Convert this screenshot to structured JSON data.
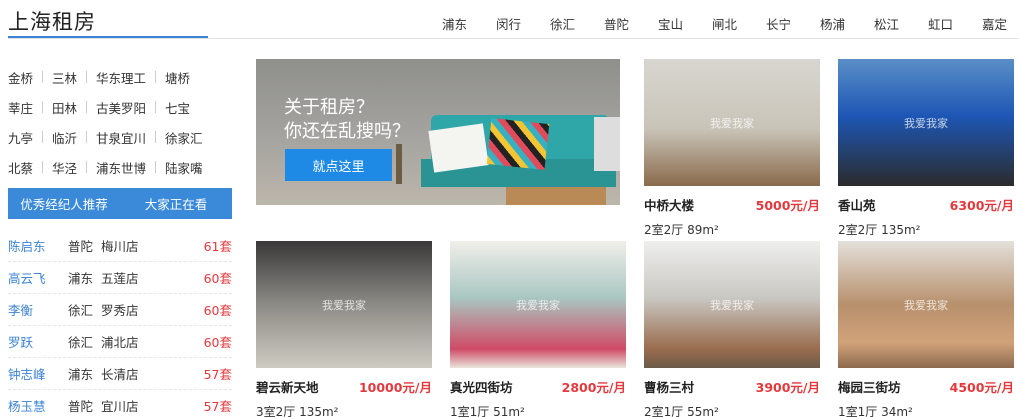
{
  "header": {
    "title": "上海租房",
    "districts": [
      "浦东",
      "闵行",
      "徐汇",
      "普陀",
      "宝山",
      "闸北",
      "长宁",
      "杨浦",
      "松江",
      "虹口",
      "嘉定"
    ]
  },
  "areas": [
    [
      "金桥",
      "三林",
      "华东理工",
      "塘桥"
    ],
    [
      "莘庄",
      "田林",
      "古美罗阳",
      "七宝"
    ],
    [
      "九亭",
      "临沂",
      "甘泉宜川",
      "徐家汇"
    ],
    [
      "北蔡",
      "华泾",
      "浦东世博",
      "陆家嘴"
    ]
  ],
  "tabs": [
    "优秀经纪人推荐",
    "大家正在看"
  ],
  "agents": [
    {
      "name": "陈启东",
      "district": "普陀",
      "store": "梅川店",
      "count": "61套"
    },
    {
      "name": "高云飞",
      "district": "浦东",
      "store": "五莲店",
      "count": "60套"
    },
    {
      "name": "李衡",
      "district": "徐汇",
      "store": "罗秀店",
      "count": "60套"
    },
    {
      "name": "罗跃",
      "district": "徐汇",
      "store": "浦北店",
      "count": "60套"
    },
    {
      "name": "钟志峰",
      "district": "浦东",
      "store": "长清店",
      "count": "57套"
    },
    {
      "name": "杨玉慧",
      "district": "普陀",
      "store": "宜川店",
      "count": "57套"
    }
  ],
  "banner": {
    "line1": "关于租房？",
    "line2": "你还在乱搜吗？",
    "button": "就点这里"
  },
  "watermark": "我爱我家",
  "listings": [
    {
      "name": "中桥大楼",
      "price": "5000元/月",
      "spec": "2室2厅 89m²"
    },
    {
      "name": "香山苑",
      "price": "6300元/月",
      "spec": "2室2厅 135m²"
    },
    {
      "name": "碧云新天地",
      "price": "10000元/月",
      "spec": "3室2厅 135m²"
    },
    {
      "name": "真光四街坊",
      "price": "2800元/月",
      "spec": "1室1厅 51m²"
    },
    {
      "name": "曹杨三村",
      "price": "3900元/月",
      "spec": "2室1厅 55m²"
    },
    {
      "name": "梅园三街坊",
      "price": "4500元/月",
      "spec": "1室1厅 34m²"
    }
  ]
}
